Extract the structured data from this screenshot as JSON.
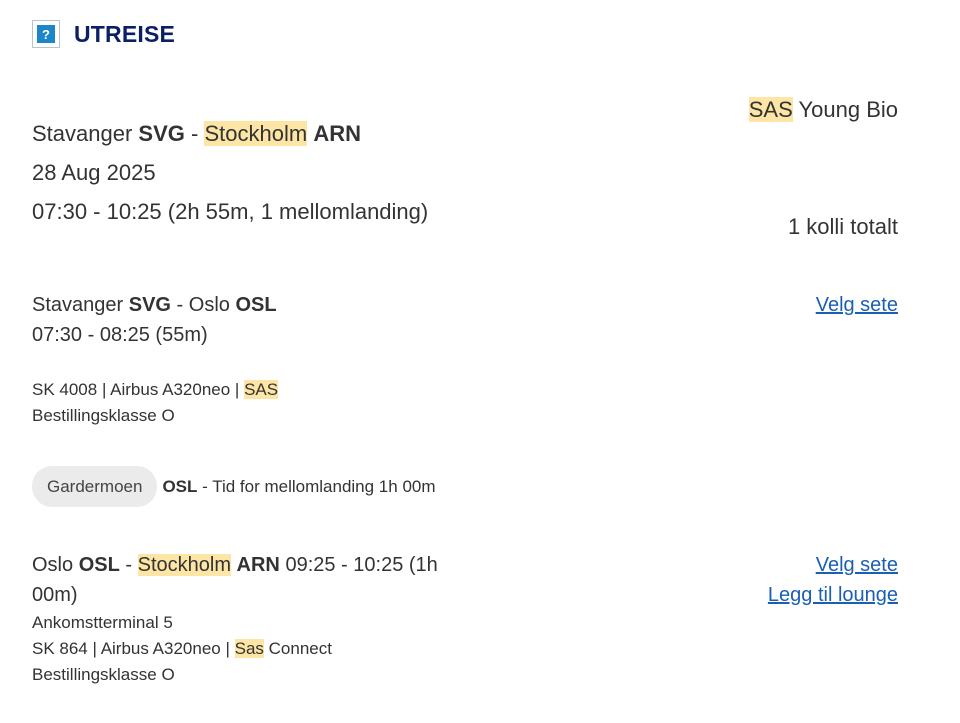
{
  "header": {
    "help_icon_glyph": "?",
    "title": "UTREISE"
  },
  "summary": {
    "origin_city": "Stavanger",
    "origin_code": "SVG",
    "separator": "-",
    "dest_city": "Stockholm",
    "dest_code": "ARN",
    "date": "28 Aug 2025",
    "times": "07:30 - 10:25 (2h 55m, 1 mellomlanding)"
  },
  "fare": {
    "brand": "SAS",
    "name": "Young Bio"
  },
  "baggage": {
    "label": "1 kolli totalt"
  },
  "segment1": {
    "origin_city": "Stavanger",
    "origin_code": "SVG",
    "separator": "-",
    "dest_city": "Oslo",
    "dest_code": "OSL",
    "times": "07:30 - 08:25 (55m)",
    "flight_info_prefix": "SK 4008 | Airbus A320neo |",
    "carrier": "SAS",
    "booking_class": "Bestillingsklasse O",
    "select_seat_label": "Velg sete"
  },
  "layover": {
    "airport_name": "Gardermoen",
    "airport_code": "OSL",
    "text": "- Tid for mellomlanding 1h 00m"
  },
  "segment2": {
    "origin_city": "Oslo",
    "origin_code": "OSL",
    "separator": "-",
    "dest_city": "Stockholm",
    "dest_code": "ARN",
    "times": "09:25 - 10:25 (1h 00m)",
    "terminal": "Ankomstterminal 5",
    "flight_info_prefix": "SK 864 | Airbus A320neo |",
    "carrier": "Sas",
    "carrier_suffix": "Connect",
    "booking_class": "Bestillingsklasse O",
    "select_seat_label": "Velg sete",
    "add_lounge_label": "Legg til lounge"
  },
  "colors": {
    "title": "#0b1f66",
    "link": "#1a5fb4",
    "highlight": "#fde5a6",
    "pill_bg": "#ebebeb"
  }
}
